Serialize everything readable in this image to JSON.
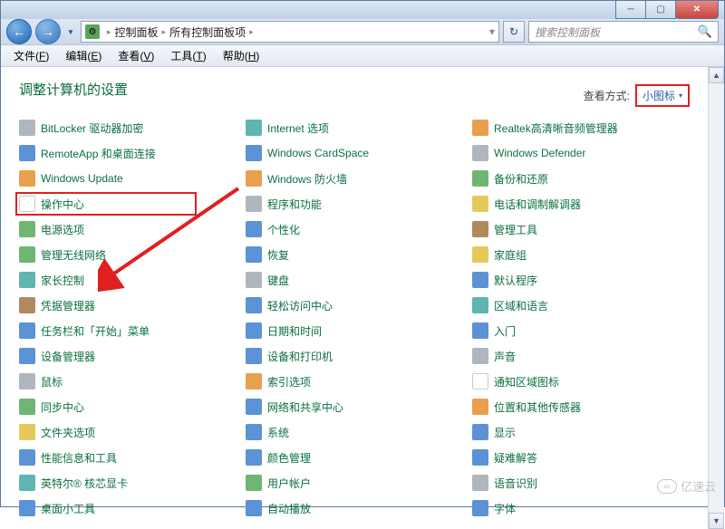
{
  "titlebar": {
    "min": "─",
    "max": "▢",
    "close": "✕"
  },
  "nav": {
    "back": "←",
    "forward": "→",
    "drop": "▼",
    "refresh": "↻"
  },
  "breadcrumb": {
    "root": "控制面板",
    "leaf": "所有控制面板项",
    "sep": "▸"
  },
  "search": {
    "placeholder": "搜索控制面板",
    "icon": "🔍"
  },
  "menus": [
    {
      "label": "文件",
      "key": "F"
    },
    {
      "label": "编辑",
      "key": "E"
    },
    {
      "label": "查看",
      "key": "V"
    },
    {
      "label": "工具",
      "key": "T"
    },
    {
      "label": "帮助",
      "key": "H"
    }
  ],
  "heading": "调整计算机的设置",
  "view": {
    "label": "查看方式:",
    "mode": "小图标",
    "drop": "▾"
  },
  "items_col1": [
    "BitLocker 驱动器加密",
    "RemoteApp 和桌面连接",
    "Windows Update",
    "操作中心",
    "电源选项",
    "管理无线网络",
    "家长控制",
    "凭据管理器",
    "任务栏和「开始」菜单",
    "设备管理器",
    "鼠标",
    "同步中心",
    "文件夹选项",
    "性能信息和工具",
    "英特尔® 核芯显卡",
    "桌面小工具"
  ],
  "items_col2": [
    "Internet 选项",
    "Windows CardSpace",
    "Windows 防火墙",
    "程序和功能",
    "个性化",
    "恢复",
    "键盘",
    "轻松访问中心",
    "日期和时间",
    "设备和打印机",
    "索引选项",
    "网络和共享中心",
    "系统",
    "颜色管理",
    "用户帐户",
    "自动播放"
  ],
  "items_col3": [
    "Realtek高清晰音频管理器",
    "Windows Defender",
    "备份和还原",
    "电话和调制解调器",
    "管理工具",
    "家庭组",
    "默认程序",
    "区域和语言",
    "入门",
    "声音",
    "通知区域图标",
    "位置和其他传感器",
    "显示",
    "疑难解答",
    "语音识别",
    "字体"
  ],
  "icon_colors_col1": [
    "bg-gray",
    "bg-blue",
    "bg-orange",
    "bg-white",
    "bg-green",
    "bg-green",
    "bg-teal",
    "bg-brown",
    "bg-blue",
    "bg-blue",
    "bg-gray",
    "bg-green",
    "bg-yellow",
    "bg-blue",
    "bg-teal",
    "bg-blue"
  ],
  "icon_colors_col2": [
    "bg-teal",
    "bg-blue",
    "bg-orange",
    "bg-gray",
    "bg-blue",
    "bg-blue",
    "bg-gray",
    "bg-blue",
    "bg-blue",
    "bg-blue",
    "bg-orange",
    "bg-blue",
    "bg-blue",
    "bg-blue",
    "bg-green",
    "bg-blue"
  ],
  "icon_colors_col3": [
    "bg-orange",
    "bg-gray",
    "bg-green",
    "bg-yellow",
    "bg-brown",
    "bg-yellow",
    "bg-blue",
    "bg-teal",
    "bg-blue",
    "bg-gray",
    "bg-white",
    "bg-orange",
    "bg-blue",
    "bg-blue",
    "bg-gray",
    "bg-blue"
  ],
  "highlight_index": 3,
  "watermark": "亿速云"
}
